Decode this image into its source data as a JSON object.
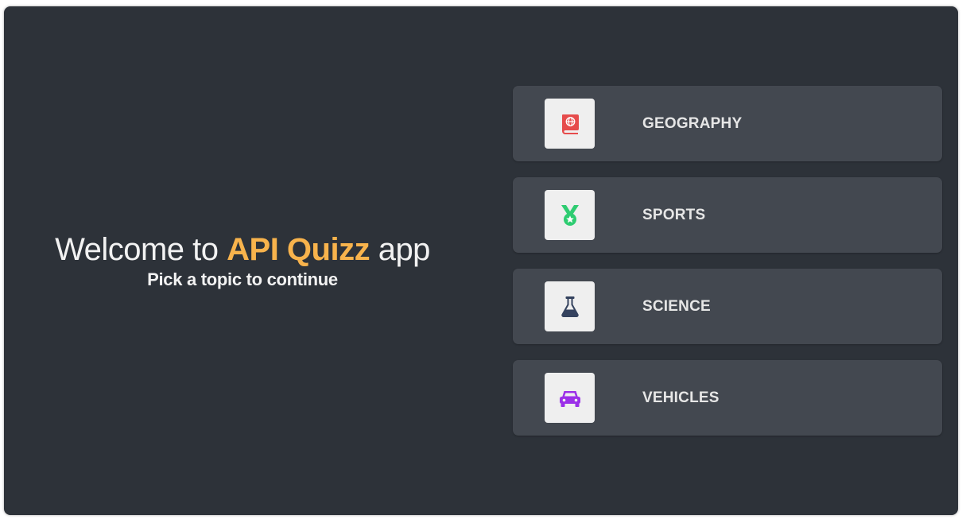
{
  "intro": {
    "welcome_prefix": "Welcome to ",
    "brand_name": "API Quizz",
    "welcome_suffix": " app",
    "subtitle": "Pick a topic to continue"
  },
  "colors": {
    "background": "#2d3239",
    "card": "#434850",
    "brand_accent": "#f8b34c",
    "geography_icon": "#e64c4c",
    "sports_icon": "#2ecc71",
    "science_icon": "#34425e",
    "vehicles_icon": "#9b30e8"
  },
  "topics": [
    {
      "label": "GEOGRAPHY",
      "icon": "atlas-book-icon"
    },
    {
      "label": "SPORTS",
      "icon": "medal-icon"
    },
    {
      "label": "SCIENCE",
      "icon": "flask-icon"
    },
    {
      "label": "VEHICLES",
      "icon": "car-icon"
    }
  ]
}
